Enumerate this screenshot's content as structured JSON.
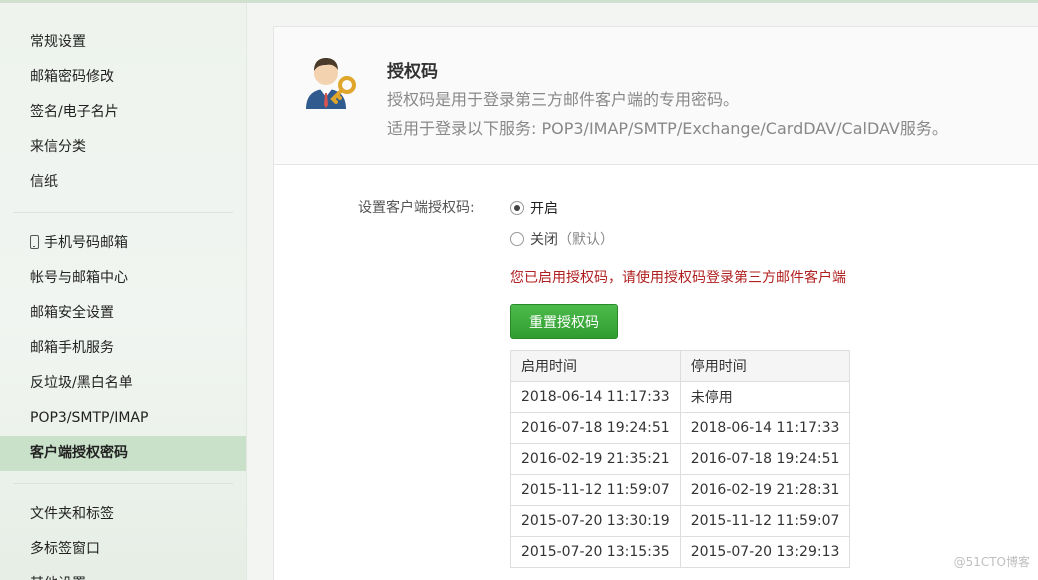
{
  "sidebar": {
    "group1": [
      "常规设置",
      "邮箱密码修改",
      "签名/电子名片",
      "来信分类",
      "信纸"
    ],
    "group2": [
      "手机号码邮箱",
      "帐号与邮箱中心",
      "邮箱安全设置",
      "邮箱手机服务",
      "反垃圾/黑白名单",
      "POP3/SMTP/IMAP",
      "客户端授权密码"
    ],
    "group3": [
      "文件夹和标签",
      "多标签窗口",
      "其他设置"
    ],
    "active": "客户端授权密码",
    "phone_icon": "phone-icon"
  },
  "header": {
    "title": "授权码",
    "desc1": "授权码是用于登录第三方邮件客户端的专用密码。",
    "desc2": "适用于登录以下服务: POP3/IMAP/SMTP/Exchange/CardDAV/CalDAV服务。",
    "icon": "user-key-icon"
  },
  "form": {
    "label": "设置客户端授权码:",
    "option_on": "开启",
    "option_off": "关闭",
    "option_off_hint": "（默认）",
    "selected": "开启",
    "notice": "您已启用授权码，请使用授权码登录第三方邮件客户端",
    "reset_button": "重置授权码"
  },
  "history": {
    "headers": [
      "启用时间",
      "停用时间"
    ],
    "rows": [
      [
        "2018-06-14 11:17:33",
        "未停用"
      ],
      [
        "2016-07-18 19:24:51",
        "2018-06-14 11:17:33"
      ],
      [
        "2016-02-19 21:35:21",
        "2016-07-18 19:24:51"
      ],
      [
        "2015-11-12 11:59:07",
        "2016-02-19 21:28:31"
      ],
      [
        "2015-07-20 13:30:19",
        "2015-11-12 11:59:07"
      ],
      [
        "2015-07-20 13:15:35",
        "2015-07-20 13:29:13"
      ]
    ]
  },
  "watermark": "@51CTO博客",
  "colors": {
    "accent_green": "#36a436",
    "notice_red": "#b01f1f",
    "active_bg": "#c9e0c9"
  }
}
